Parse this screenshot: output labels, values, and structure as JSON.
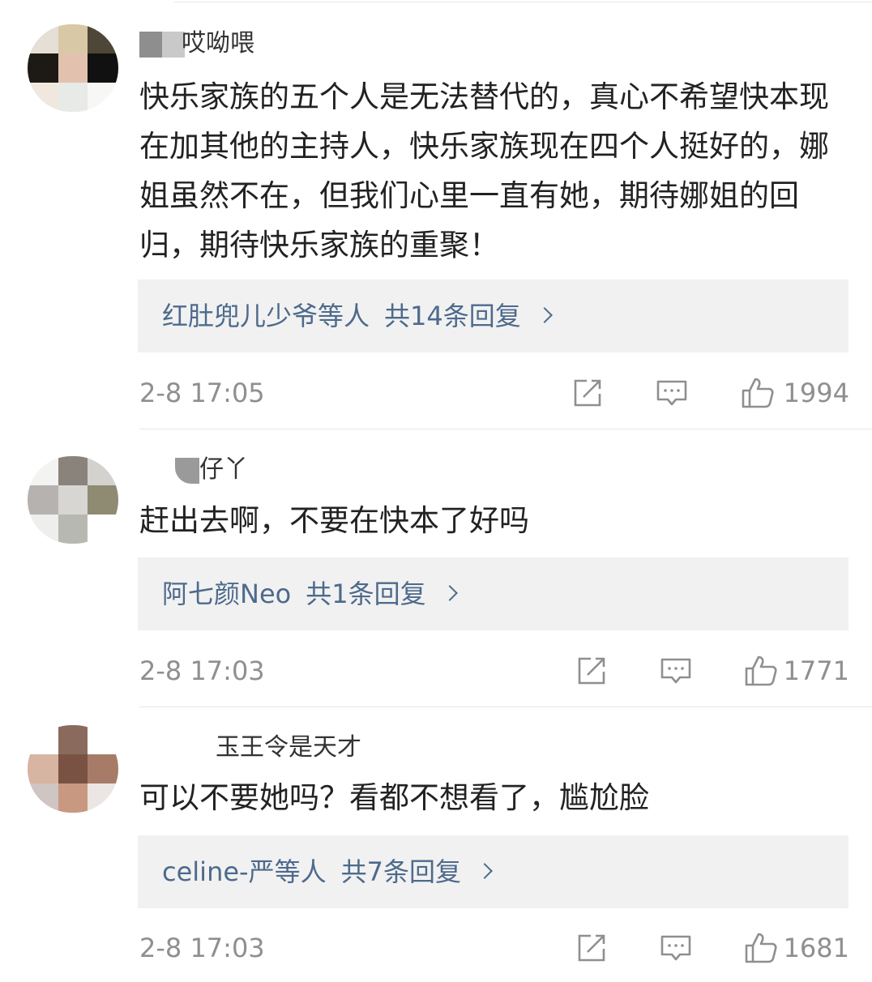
{
  "comments": [
    {
      "username": "哎呦喂",
      "text": "快乐家族的五个人是无法替代的，真心不希望快本现在加其他的主持人，快乐家族现在四个人挺好的，娜姐虽然不在，但我们心里一直有她，期待娜姐的回归，期待快乐家族的重聚！",
      "reply_users": "红肚兜儿少爷等人",
      "reply_count": "共14条回复",
      "time": "2-8 17:05",
      "likes": "1994"
    },
    {
      "username": "仔丫",
      "text": "赶出去啊，不要在快本了好吗",
      "reply_users": "阿七颜Neo",
      "reply_count": "共1条回复",
      "time": "2-8 17:03",
      "likes": "1771"
    },
    {
      "username": "玉王令是天才",
      "text": "可以不要她吗？看都不想看了，尴尬脸",
      "reply_users": "celine-严等人",
      "reply_count": "共7条回复",
      "time": "2-8 17:03",
      "likes": "1681"
    }
  ],
  "icons": {
    "share": "share-icon",
    "comment": "comment-icon",
    "like": "like-icon"
  },
  "colors": {
    "reply_link": "#4d6a8c",
    "meta_gray": "#8f8f8f",
    "reply_bg": "#f1f1f1"
  }
}
